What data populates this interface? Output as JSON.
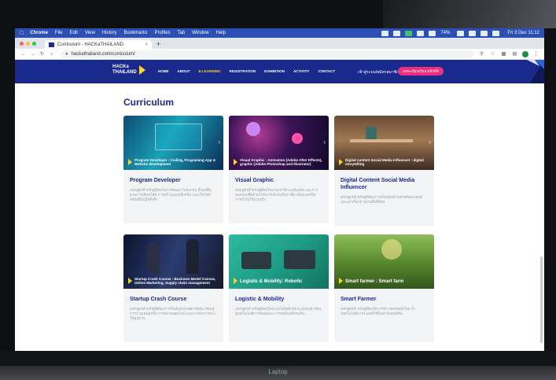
{
  "menubar": {
    "app": "Chrome",
    "items": [
      "File",
      "Edit",
      "View",
      "History",
      "Bookmarks",
      "Profiles",
      "Tab",
      "Window",
      "Help"
    ],
    "battery": "74%",
    "clock": "Fri 3 Dec 11:12"
  },
  "browser": {
    "tab_title": "Curriculum - HACKaTHAILAND",
    "url": "hackathailand.com/curriculum/"
  },
  "site": {
    "logo_line1": "HACKa",
    "logo_line2": "THAILAND",
    "nav": [
      "HOME",
      "ABOUT",
      "E-LEARNING",
      "REGISTRATION",
      "EXHIBITION",
      "ACTIVITY",
      "CONTACT"
    ],
    "login": "เข้าสู่ระบบ/สมัครสมาชิก",
    "register": "ลงทะเบียนเรียน คลิกที่นี่"
  },
  "page": {
    "title": "Curriculum"
  },
  "cards": [
    {
      "caption": "Program Developer : Coding, Programing App & Website development",
      "title": "Program Developer",
      "desc": "หลักสูตรสำหรับผู้ที่สนใจการพัฒนาโปรแกรม ตั้งแต่พื้นฐานการเขียนโค้ด การสร้างแอปพลิเคชัน และเว็บไซต์ พร้อมฝึกปฏิบัติจริง"
    },
    {
      "caption": "Visual Graphic : Animation (Adobe After Effects), graphic (Adobe Photoshop and Illustrator)",
      "title": "Visual Graphic",
      "desc": "หลักสูตรสำหรับผู้ที่สนใจงานกราฟิก แอนิเมชัน และการออกแบบสื่อด้วยโปรแกรมระดับมืออาชีพ พร้อมเทคนิคการนำไปใช้งานจริง"
    },
    {
      "caption": "Digital content Social Media Influencer : digital storytelling",
      "title": "Digital Content Social Media Influencer",
      "desc": "หลักสูตรสำหรับผู้ที่ต้องการเป็นนักสร้างสรรค์คอนเทนต์ และเล่าเรื่องราวผ่านสื่อดิจิทัล"
    },
    {
      "caption": "Startup Crash Course : Business Model Canvas, Online Marketing, Supply chain management",
      "title": "Startup Crash Course",
      "desc": "หลักสูตรสำหรับผู้ที่ต้องการเริ่มต้นธุรกิจสตาร์ทอัพ เรียนรู้การวางแผนธุรกิจ การตลาดออนไลน์ และการจัดการห่วงโซ่อุปทาน"
    },
    {
      "caption": "Logistic & Mobility: Robotic",
      "title": "Logistic & Mobility",
      "desc": "หลักสูตรสำหรับผู้ที่สนใจระบบโลจิสติกส์และหุ่นยนต์ เรียนรู้เทคโนโลยีการขนส่งและการเคลื่อนที่อัจฉริยะ"
    },
    {
      "caption": "Smart farmer : Smart farm",
      "title": "Smart Farmer",
      "desc": "หลักสูตรสำหรับผู้ที่สนใจการทำเกษตรสมัยใหม่ นำเทคโนโลยีมาประยุกต์ใช้ในฟาร์มอัจฉริยะ"
    }
  ],
  "laptop_label": "Laptop"
}
